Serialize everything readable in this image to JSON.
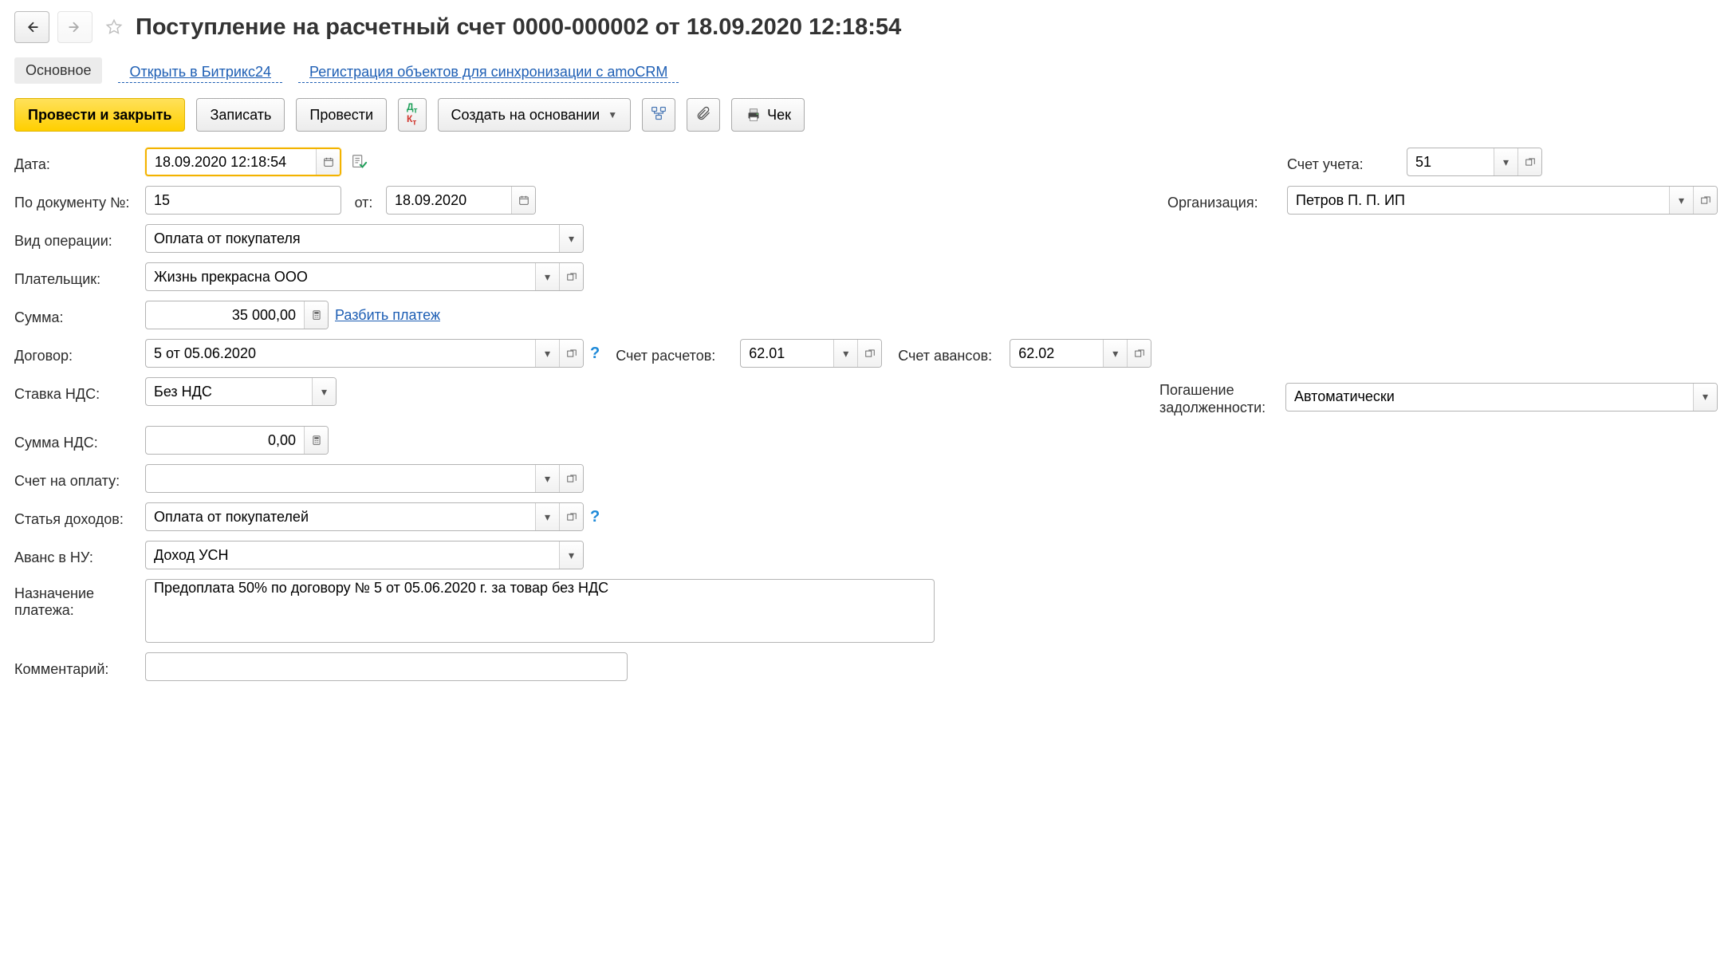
{
  "header": {
    "title": "Поступление на расчетный счет 0000-000002 от 18.09.2020 12:18:54"
  },
  "tabs": {
    "main": "Основное",
    "bitrix": "Открыть в Битрикс24",
    "amocrm": "Регистрация объектов для синхронизации с amoCRM"
  },
  "toolbar": {
    "post_close": "Провести и закрыть",
    "save": "Записать",
    "post": "Провести",
    "create_based": "Создать на основании",
    "cheque": "Чек"
  },
  "labels": {
    "date": "Дата:",
    "doc_no": "По документу №:",
    "from": "от:",
    "op_type": "Вид операции:",
    "payer": "Плательщик:",
    "sum": "Сумма:",
    "split_payment": "Разбить платеж",
    "contract": "Договор:",
    "vat_rate": "Ставка НДС:",
    "vat_sum": "Сумма НДС:",
    "invoice": "Счет на оплату:",
    "income_article": "Статья доходов:",
    "prepayment_nu": "Аванс в НУ:",
    "purpose": "Назначение платежа:",
    "comment": "Комментарий:",
    "account": "Счет учета:",
    "organization": "Организация:",
    "settlement_account": "Счет расчетов:",
    "advance_account": "Счет авансов:",
    "debt_repayment": "Погашение задолженности:"
  },
  "fields": {
    "date": "18.09.2020 12:18:54",
    "doc_no": "15",
    "doc_date": "18.09.2020",
    "op_type": "Оплата от покупателя",
    "payer": "Жизнь прекрасна ООО",
    "sum": "35 000,00",
    "contract": "5 от 05.06.2020",
    "vat_rate": "Без НДС",
    "vat_sum": "0,00",
    "invoice": "",
    "income_article": "Оплата от покупателей",
    "prepayment_nu": "Доход УСН",
    "purpose": "Предоплата 50% по договору № 5 от 05.06.2020 г. за товар без НДС",
    "comment": "",
    "account": "51",
    "organization": "Петров П. П. ИП",
    "settlement_account": "62.01",
    "advance_account": "62.02",
    "debt_repayment": "Автоматически"
  }
}
